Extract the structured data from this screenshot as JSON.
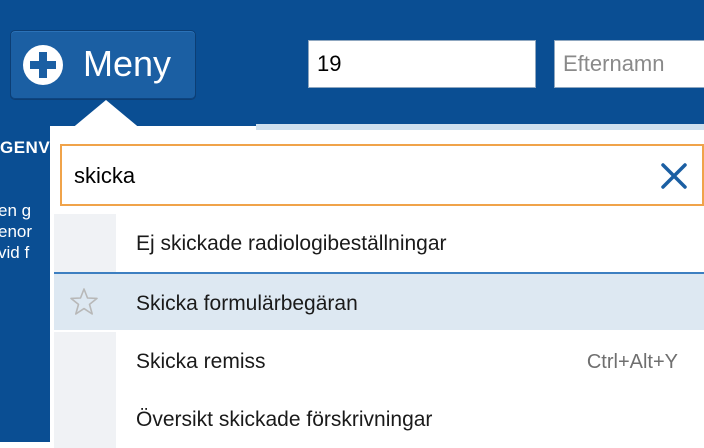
{
  "menu_button": {
    "label": "Meny",
    "icon": "plus-circle-icon"
  },
  "fields": {
    "id_value": "19",
    "lastname_placeholder": "Efternamn"
  },
  "sidebar": {
    "heading": "GENV",
    "lines": [
      "en g",
      "enor",
      "vid f"
    ]
  },
  "search": {
    "value": "skicka",
    "clear_icon": "close-icon",
    "border_color": "#f0a34a"
  },
  "results": [
    {
      "label": "Ej skickade radiologibeställningar",
      "shortcut": "",
      "selected": false
    },
    {
      "label": "Skicka formulärbegäran",
      "shortcut": "",
      "selected": true,
      "icon": "star-outline-icon"
    },
    {
      "label": "Skicka remiss",
      "shortcut": "Ctrl+Alt+Y",
      "selected": false
    },
    {
      "label": "Översikt skickade förskrivningar",
      "shortcut": "",
      "selected": false
    }
  ],
  "colors": {
    "header_blue": "#0a4e93",
    "selected_row": "#dde8f2",
    "selected_border": "#3d7fc1"
  }
}
